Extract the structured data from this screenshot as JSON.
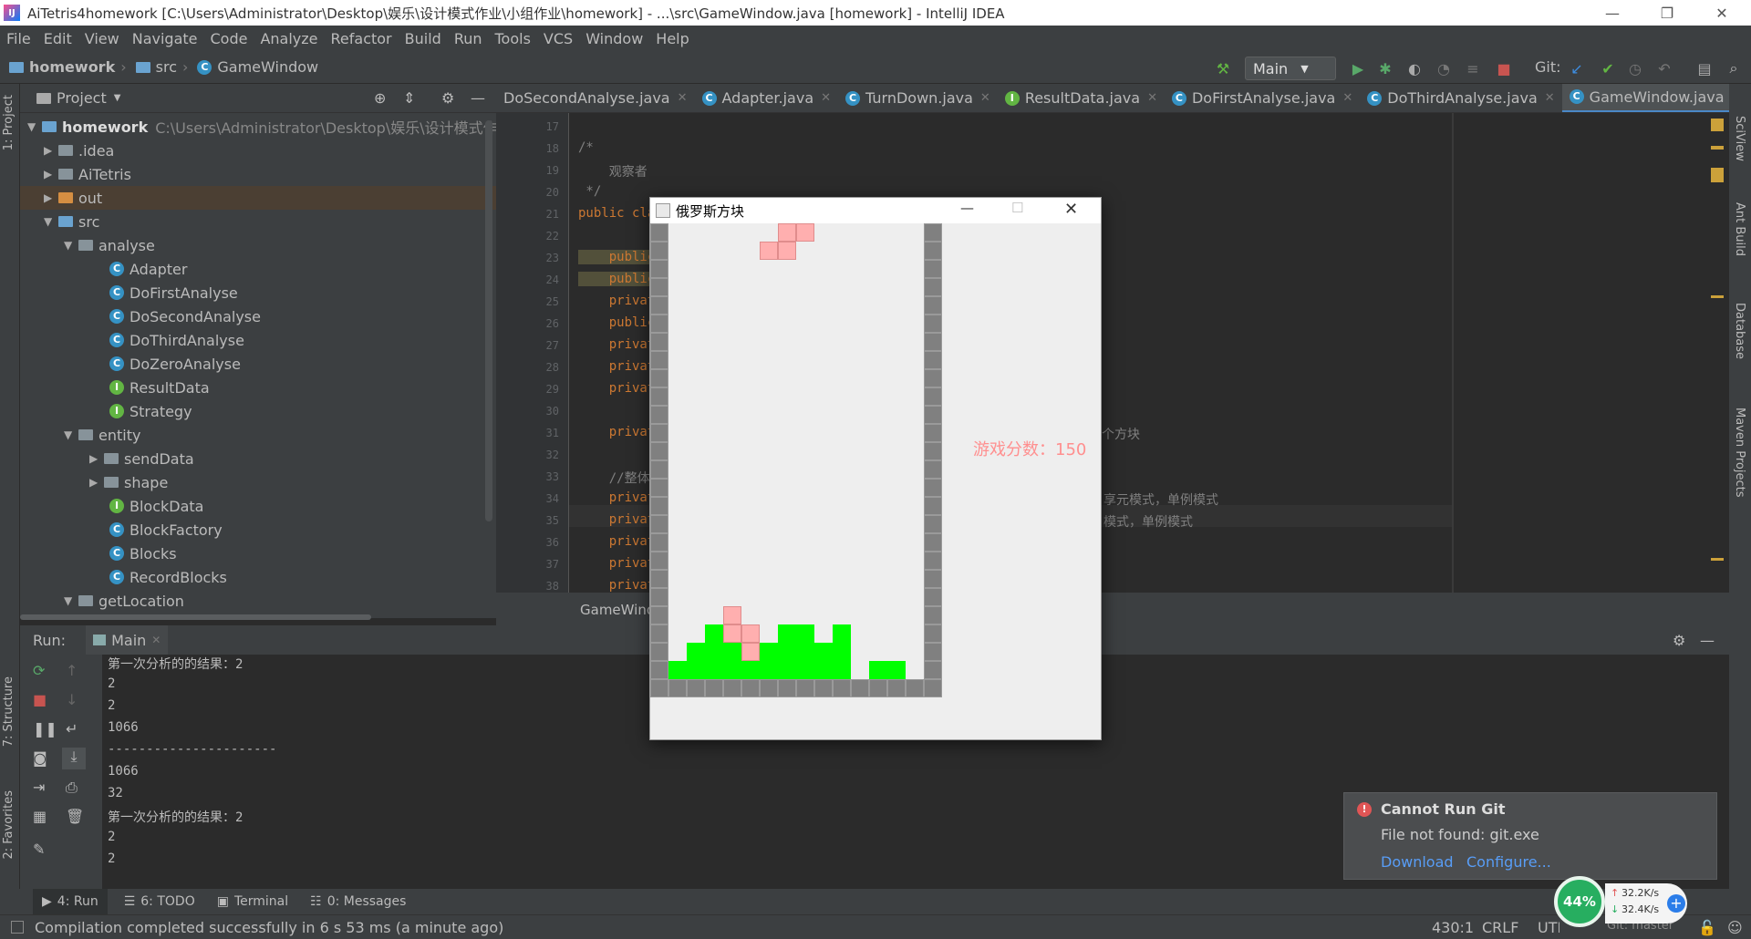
{
  "window": {
    "title": "AiTetris4homework [C:\\Users\\Administrator\\Desktop\\娱乐\\设计模式作业\\小组作业\\homework] - ...\\src\\GameWindow.java [homework] - IntelliJ IDEA"
  },
  "menu": [
    "File",
    "Edit",
    "View",
    "Navigate",
    "Code",
    "Analyze",
    "Refactor",
    "Build",
    "Run",
    "Tools",
    "VCS",
    "Window",
    "Help"
  ],
  "breadcrumb": {
    "project": "homework",
    "src": "src",
    "file": "GameWindow"
  },
  "toolbar": {
    "run_config": "Main",
    "git_label": "Git:"
  },
  "project_panel": {
    "title": "Project",
    "root_name": "homework",
    "root_path": "C:\\Users\\Administrator\\Desktop\\娱乐\\设计模式作业\\小",
    "items": [
      {
        "label": ".idea"
      },
      {
        "label": "AiTetris"
      },
      {
        "label": "out"
      },
      {
        "label": "src"
      },
      {
        "label": "analyse"
      },
      {
        "label": "Adapter"
      },
      {
        "label": "DoFirstAnalyse"
      },
      {
        "label": "DoSecondAnalyse"
      },
      {
        "label": "DoThirdAnalyse"
      },
      {
        "label": "DoZeroAnalyse"
      },
      {
        "label": "ResultData"
      },
      {
        "label": "Strategy"
      },
      {
        "label": "entity"
      },
      {
        "label": "sendData"
      },
      {
        "label": "shape"
      },
      {
        "label": "BlockData"
      },
      {
        "label": "BlockFactory"
      },
      {
        "label": "Blocks"
      },
      {
        "label": "RecordBlocks"
      },
      {
        "label": "getLocation"
      }
    ]
  },
  "editor_tabs": [
    {
      "label": "DoSecondAnalyse.java"
    },
    {
      "label": "Adapter.java"
    },
    {
      "label": "TurnDown.java"
    },
    {
      "label": "ResultData.java"
    },
    {
      "label": "DoFirstAnalyse.java"
    },
    {
      "label": "DoThirdAnalyse.java"
    },
    {
      "label": "GameWindow.java"
    }
  ],
  "editor": {
    "line_numbers": [
      "17",
      "18",
      "19",
      "20",
      "21",
      "22",
      "23",
      "24",
      "25",
      "26",
      "27",
      "28",
      "29",
      "30",
      "31",
      "32",
      "33",
      "34",
      "35",
      "36",
      "37",
      "38"
    ],
    "lines": [
      "",
      "/*",
      "    观察者",
      " */",
      "public cla",
      "",
      "    public",
      "    public",
      "    privat",
      "    public",
      "    privat",
      "    privat",
      "    privat",
      "",
      "    privat",
      "",
      "    //整体",
      "    privat",
      "    privat",
      "    privat",
      "    privat",
      "    privat"
    ],
    "overflow_text": [
      "个方块",
      "享元模式，单例模式",
      "模式，单例模式"
    ],
    "footer_tab": "GameWind"
  },
  "run": {
    "label": "Run:",
    "tab": "Main",
    "console": [
      "第一次分析的的结果：2",
      "2",
      "2",
      "1066",
      "----------------------",
      "1066",
      "32",
      "第一次分析的的结果：2",
      "2",
      "2"
    ]
  },
  "game": {
    "title": "俄罗斯方块",
    "score": "游戏分数：150"
  },
  "notification": {
    "title": "Cannot Run Git",
    "message": "File not found: git.exe",
    "link1": "Download",
    "link2": "Configure..."
  },
  "bottom_tabs": [
    {
      "label": "4: Run"
    },
    {
      "label": "6: TODO"
    },
    {
      "label": "Terminal"
    },
    {
      "label": "0: Messages"
    }
  ],
  "side_tabs": {
    "left": [
      "1: Project",
      "7: Structure",
      "2: Favorites"
    ],
    "right": [
      "SciView",
      "Ant Build",
      "Database",
      "Maven Projects"
    ]
  },
  "status": {
    "message": "Compilation completed successfully in 6 s 53 ms (a minute ago)",
    "position": "430:1",
    "line_sep": "CRLF",
    "encoding": "UTF",
    "branch": "Git: master"
  },
  "network": {
    "cpu": "44%",
    "up": "32.2K/s",
    "down": "32.4K/s"
  },
  "colors": {
    "accent": "#4a88c7",
    "falling_block": "#ffafaf",
    "landed_block": "#00ff00",
    "wall": "#808080",
    "score": "#ff8f8f"
  }
}
